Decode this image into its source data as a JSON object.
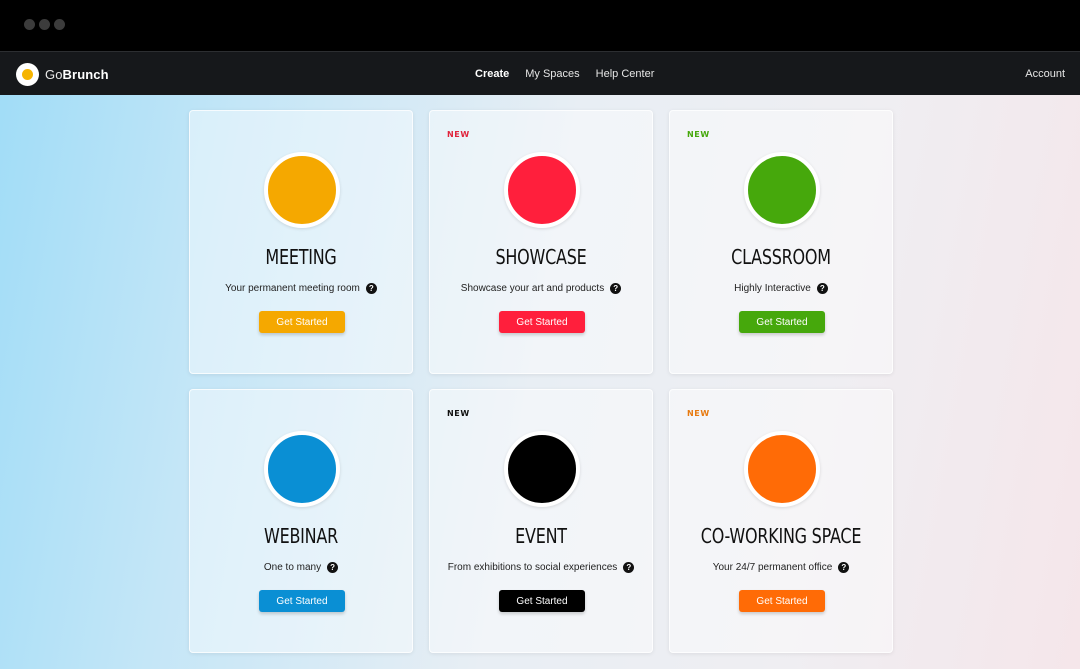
{
  "brand": {
    "go": "Go",
    "brunch": "Brunch"
  },
  "nav": {
    "links": [
      "Create",
      "My Spaces",
      "Help Center"
    ],
    "account": "Account"
  },
  "colors": {
    "meeting": "#f5a800",
    "showcase": "#ff1f3c",
    "classroom": "#46a80c",
    "webinar": "#0a8fd4",
    "event": "#000000",
    "coworking": "#ff6b06"
  },
  "cards": [
    {
      "title": "MEETING",
      "badge": "",
      "desc": "Your permanent meeting room",
      "button": "Get Started"
    },
    {
      "title": "SHOWCASE",
      "badge": "NEW",
      "desc": "Showcase your art and products",
      "button": "Get Started"
    },
    {
      "title": "CLASSROOM",
      "badge": "NEW",
      "desc": "Highly Interactive",
      "button": "Get Started"
    },
    {
      "title": "WEBINAR",
      "badge": "",
      "desc": "One to many",
      "button": "Get Started"
    },
    {
      "title": "EVENT",
      "badge": "NEW",
      "desc": "From exhibitions to social experiences",
      "button": "Get Started"
    },
    {
      "title": "CO-WORKING SPACE",
      "badge": "NEW",
      "desc": "Your 24/7 permanent office",
      "button": "Get Started"
    }
  ],
  "help_glyph": "?"
}
